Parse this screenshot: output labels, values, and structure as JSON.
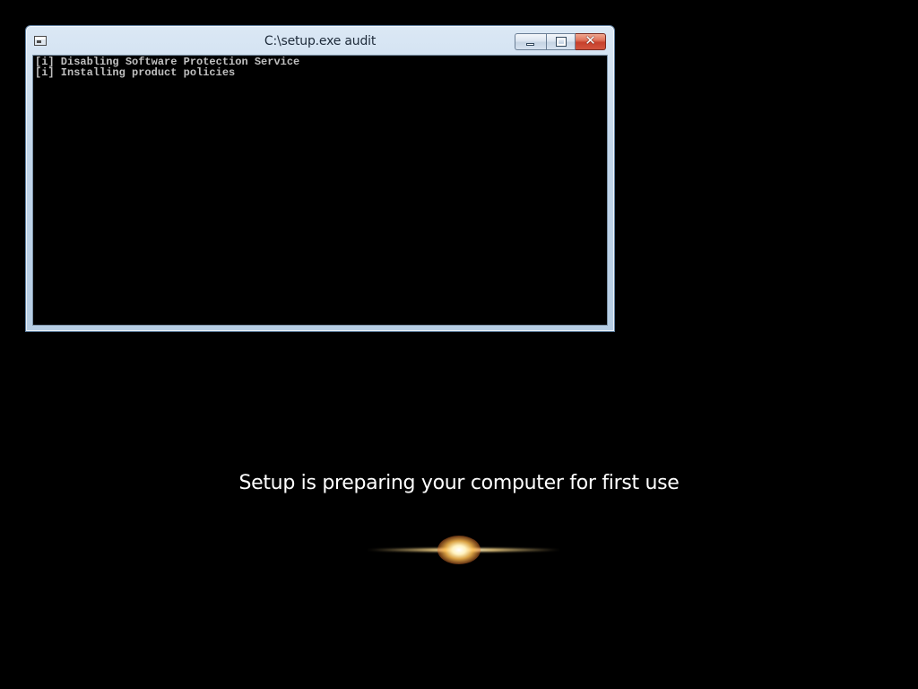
{
  "console_window": {
    "title": "C:\\setup.exe audit",
    "lines": [
      "[i] Disabling Software Protection Service",
      "[i] Installing product policies"
    ]
  },
  "setup": {
    "message": "Setup is preparing your computer for first use"
  },
  "icons": {
    "window_icon": "console-window-icon",
    "minimize": "minimize-icon",
    "maximize": "maximize-icon",
    "close": "close-icon",
    "close_glyph": "✕"
  },
  "colors": {
    "background": "#000000",
    "console_text": "#c0c0c0",
    "message_text": "#ffffff",
    "close_button": "#c7402c"
  }
}
